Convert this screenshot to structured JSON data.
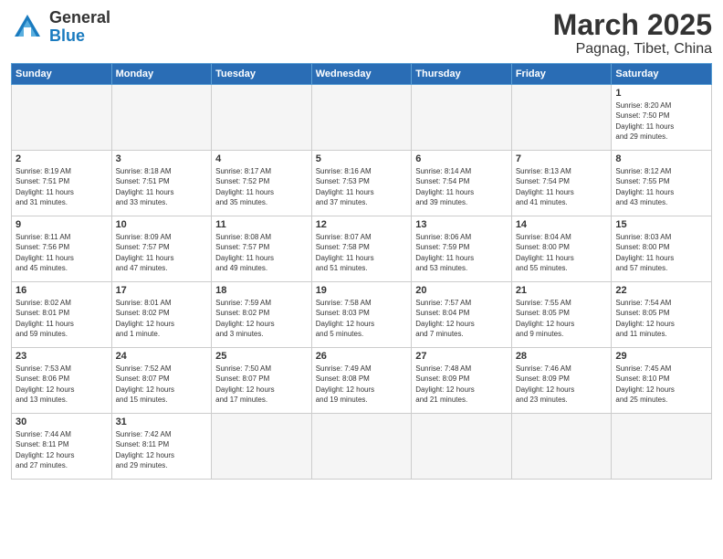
{
  "header": {
    "logo_general": "General",
    "logo_blue": "Blue",
    "month_title": "March 2025",
    "location": "Pagnag, Tibet, China"
  },
  "weekdays": [
    "Sunday",
    "Monday",
    "Tuesday",
    "Wednesday",
    "Thursday",
    "Friday",
    "Saturday"
  ],
  "weeks": [
    [
      {
        "day": "",
        "info": ""
      },
      {
        "day": "",
        "info": ""
      },
      {
        "day": "",
        "info": ""
      },
      {
        "day": "",
        "info": ""
      },
      {
        "day": "",
        "info": ""
      },
      {
        "day": "",
        "info": ""
      },
      {
        "day": "1",
        "info": "Sunrise: 8:20 AM\nSunset: 7:50 PM\nDaylight: 11 hours\nand 29 minutes."
      }
    ],
    [
      {
        "day": "2",
        "info": "Sunrise: 8:19 AM\nSunset: 7:51 PM\nDaylight: 11 hours\nand 31 minutes."
      },
      {
        "day": "3",
        "info": "Sunrise: 8:18 AM\nSunset: 7:51 PM\nDaylight: 11 hours\nand 33 minutes."
      },
      {
        "day": "4",
        "info": "Sunrise: 8:17 AM\nSunset: 7:52 PM\nDaylight: 11 hours\nand 35 minutes."
      },
      {
        "day": "5",
        "info": "Sunrise: 8:16 AM\nSunset: 7:53 PM\nDaylight: 11 hours\nand 37 minutes."
      },
      {
        "day": "6",
        "info": "Sunrise: 8:14 AM\nSunset: 7:54 PM\nDaylight: 11 hours\nand 39 minutes."
      },
      {
        "day": "7",
        "info": "Sunrise: 8:13 AM\nSunset: 7:54 PM\nDaylight: 11 hours\nand 41 minutes."
      },
      {
        "day": "8",
        "info": "Sunrise: 8:12 AM\nSunset: 7:55 PM\nDaylight: 11 hours\nand 43 minutes."
      }
    ],
    [
      {
        "day": "9",
        "info": "Sunrise: 8:11 AM\nSunset: 7:56 PM\nDaylight: 11 hours\nand 45 minutes."
      },
      {
        "day": "10",
        "info": "Sunrise: 8:09 AM\nSunset: 7:57 PM\nDaylight: 11 hours\nand 47 minutes."
      },
      {
        "day": "11",
        "info": "Sunrise: 8:08 AM\nSunset: 7:57 PM\nDaylight: 11 hours\nand 49 minutes."
      },
      {
        "day": "12",
        "info": "Sunrise: 8:07 AM\nSunset: 7:58 PM\nDaylight: 11 hours\nand 51 minutes."
      },
      {
        "day": "13",
        "info": "Sunrise: 8:06 AM\nSunset: 7:59 PM\nDaylight: 11 hours\nand 53 minutes."
      },
      {
        "day": "14",
        "info": "Sunrise: 8:04 AM\nSunset: 8:00 PM\nDaylight: 11 hours\nand 55 minutes."
      },
      {
        "day": "15",
        "info": "Sunrise: 8:03 AM\nSunset: 8:00 PM\nDaylight: 11 hours\nand 57 minutes."
      }
    ],
    [
      {
        "day": "16",
        "info": "Sunrise: 8:02 AM\nSunset: 8:01 PM\nDaylight: 11 hours\nand 59 minutes."
      },
      {
        "day": "17",
        "info": "Sunrise: 8:01 AM\nSunset: 8:02 PM\nDaylight: 12 hours\nand 1 minute."
      },
      {
        "day": "18",
        "info": "Sunrise: 7:59 AM\nSunset: 8:02 PM\nDaylight: 12 hours\nand 3 minutes."
      },
      {
        "day": "19",
        "info": "Sunrise: 7:58 AM\nSunset: 8:03 PM\nDaylight: 12 hours\nand 5 minutes."
      },
      {
        "day": "20",
        "info": "Sunrise: 7:57 AM\nSunset: 8:04 PM\nDaylight: 12 hours\nand 7 minutes."
      },
      {
        "day": "21",
        "info": "Sunrise: 7:55 AM\nSunset: 8:05 PM\nDaylight: 12 hours\nand 9 minutes."
      },
      {
        "day": "22",
        "info": "Sunrise: 7:54 AM\nSunset: 8:05 PM\nDaylight: 12 hours\nand 11 minutes."
      }
    ],
    [
      {
        "day": "23",
        "info": "Sunrise: 7:53 AM\nSunset: 8:06 PM\nDaylight: 12 hours\nand 13 minutes."
      },
      {
        "day": "24",
        "info": "Sunrise: 7:52 AM\nSunset: 8:07 PM\nDaylight: 12 hours\nand 15 minutes."
      },
      {
        "day": "25",
        "info": "Sunrise: 7:50 AM\nSunset: 8:07 PM\nDaylight: 12 hours\nand 17 minutes."
      },
      {
        "day": "26",
        "info": "Sunrise: 7:49 AM\nSunset: 8:08 PM\nDaylight: 12 hours\nand 19 minutes."
      },
      {
        "day": "27",
        "info": "Sunrise: 7:48 AM\nSunset: 8:09 PM\nDaylight: 12 hours\nand 21 minutes."
      },
      {
        "day": "28",
        "info": "Sunrise: 7:46 AM\nSunset: 8:09 PM\nDaylight: 12 hours\nand 23 minutes."
      },
      {
        "day": "29",
        "info": "Sunrise: 7:45 AM\nSunset: 8:10 PM\nDaylight: 12 hours\nand 25 minutes."
      }
    ],
    [
      {
        "day": "30",
        "info": "Sunrise: 7:44 AM\nSunset: 8:11 PM\nDaylight: 12 hours\nand 27 minutes."
      },
      {
        "day": "31",
        "info": "Sunrise: 7:42 AM\nSunset: 8:11 PM\nDaylight: 12 hours\nand 29 minutes."
      },
      {
        "day": "",
        "info": ""
      },
      {
        "day": "",
        "info": ""
      },
      {
        "day": "",
        "info": ""
      },
      {
        "day": "",
        "info": ""
      },
      {
        "day": "",
        "info": ""
      }
    ]
  ]
}
